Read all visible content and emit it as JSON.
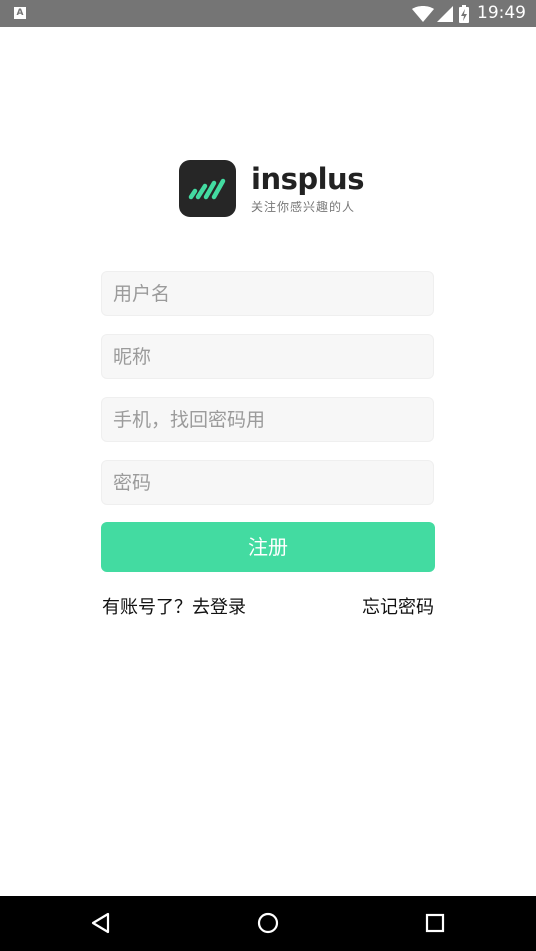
{
  "status_bar": {
    "time": "19:49",
    "app_icon_letter": "A",
    "icons": [
      "wifi-icon",
      "signal-icon",
      "battery-charging-icon"
    ],
    "background": "#757575"
  },
  "brand": {
    "name": "insplus",
    "tagline": "关注你感兴趣的人",
    "logo_colors": {
      "background": "#262626",
      "stripes": "#43dba1"
    }
  },
  "form": {
    "username_placeholder": "用户名",
    "nickname_placeholder": "昵称",
    "phone_placeholder": "手机，找回密码用",
    "password_placeholder": "密码",
    "register_label": "注册"
  },
  "links": {
    "login": "有账号了？去登录",
    "forgot_password": "忘记密码"
  },
  "nav_bar": {
    "buttons": [
      "back-icon",
      "home-icon",
      "recents-icon"
    ]
  },
  "colors": {
    "accent": "#43dba1",
    "field_background": "#f7f7f7",
    "placeholder": "#9b9b9b",
    "nav_background": "#000000"
  }
}
